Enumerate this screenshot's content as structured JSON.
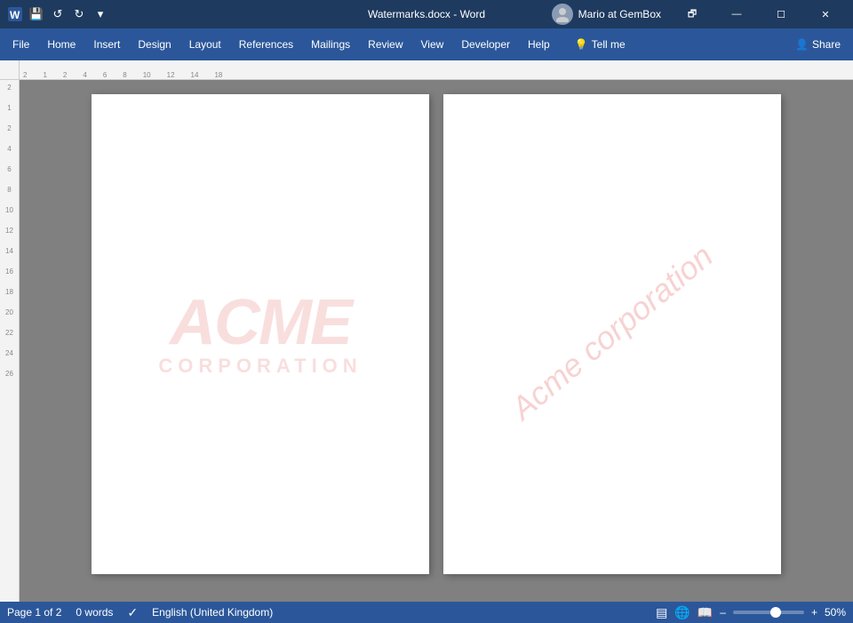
{
  "titlebar": {
    "filename": "Watermarks.docx",
    "app": "Word",
    "user": "Mario at GemBox",
    "separator": " - "
  },
  "quickaccess": {
    "save": "💾",
    "undo": "↩",
    "redo": "↪",
    "dropdown": "▾"
  },
  "winbuttons": {
    "restore": "🗗",
    "minimize": "—",
    "maximize": "☐",
    "close": "✕"
  },
  "menubar": {
    "items": [
      "File",
      "Home",
      "Insert",
      "Design",
      "Layout",
      "References",
      "Mailings",
      "Review",
      "View",
      "Developer",
      "Help"
    ]
  },
  "ribbon": {
    "tell_me_placeholder": "Tell me",
    "share_label": "Share"
  },
  "pages": [
    {
      "id": "page1",
      "watermark_type": "logo",
      "watermark_line1": "ACME",
      "watermark_line2": "CORPORATION"
    },
    {
      "id": "page2",
      "watermark_type": "text",
      "watermark_text": "Acme corporation"
    }
  ],
  "statusbar": {
    "page_info": "Page 1 of 2",
    "word_count": "0 words",
    "language": "English (United Kingdom)",
    "zoom_percent": "50%"
  },
  "ruler": {
    "ticks": [
      "2",
      "1",
      "2",
      "4",
      "6",
      "8",
      "10",
      "12",
      "14",
      "18"
    ]
  }
}
